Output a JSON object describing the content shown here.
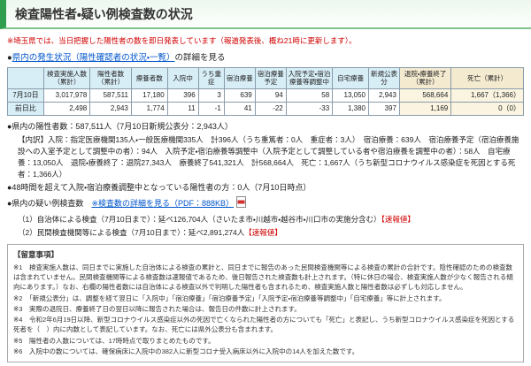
{
  "page": {
    "title": "検査陽性者・疑い例検査数の状況",
    "notice_red": "※埼玉県では、当日把握した陽性者の数を即日発表しています（報道発表後、概ね21時に更新します）。"
  },
  "status_link": {
    "prefix": "●",
    "link_text": "県内の発生状況（陽性確認者の状況・一覧）",
    "suffix": "の詳細を見る"
  },
  "table": {
    "headers": [
      "",
      "検査実施人数（累計）",
      "陽性者数（累計）",
      "療養者数",
      "入院中",
      "うち重症",
      "宿泊療養",
      "宿泊療養予定",
      "入院予定・宿泊療養等調整中",
      "自宅療養",
      "新規公表分",
      "退院・療養終了（累計）",
      "死亡（累計）"
    ],
    "rows": [
      {
        "label": "7月10日",
        "values": [
          "3,017,978",
          "587,511",
          "17,180",
          "396",
          "3",
          "639",
          "94",
          "58",
          "13,050",
          "2,943",
          "568,664",
          "1,667（1,366）"
        ]
      },
      {
        "label": "前日比",
        "values": [
          "2,498",
          "2,943",
          "1,774",
          "11",
          "-1",
          "41",
          "-22",
          "-33",
          "1,380",
          "397",
          "1,169",
          "0（0）"
        ]
      }
    ]
  },
  "summary": {
    "positives_line": "●県内の陽性者数：587,511人（7月10日新規公表分：2,943人）",
    "breakdown": "【内訳】入院：指定医療機関135人・一般医療機関335人　計396人（うち重篤者：0人　重症者：3人）　宿泊療養：639人　宿泊療養予定（宿泊療養施設への入室予定として調整中の者）：94人　入院予定・宿泊療養等調整中（入院予定として調整している者や宿泊療養を調整中の者）：58人　自宅療養：13,050人　退院・療養終了：退院27,343人　療養終了541,321人　計568,664人　死亡：1,667人（うち新型コロナウイルス感染症を死因とする死者：1,366人）",
    "over48h_line": "●48時間を超えて入院・宿泊療養調整中となっている陽性者の方：0人（7月10日時点）",
    "suspected": {
      "prefix": "●県内の疑い例検査数　",
      "link": "※検査数の詳細を見る（PDF：888KB）",
      "items": [
        {
          "text": "（1）自治体による検査（7月10日まで）：延べ126,704人（さいたま市・川越市・越谷市・川口市の実施分含む）",
          "badge": "【速報値】"
        },
        {
          "text": "（2）民間検査機関等による検査（7月10日まで）：延べ2,891,274人",
          "badge": "【速報値】"
        }
      ]
    }
  },
  "notes": {
    "title": "【留意事項】",
    "items": [
      "※1　検査実施人数は、同日までに実施した自治体による検査の累計と、同日までに報告のあった民間検査機関等による検査の累計の合計です。陰性確認のための検査数は含まれていません。民間検査機関等による検査数は速報値であるため、後日報告された検査数も計上されます。（特に休日の場合、検査実施人数が少なく報告される傾向にあります。）なお、右欄の陽性者数には自治体による検査以外で判明した陽性者も含まれるため、検査実施人数と陽性者数は必ずしも対応しません。",
      "※2　「新規公表分」は、調整を経て翌日に「入院中」「宿泊療養」「宿泊療養予定」「入院予定・宿泊療養等調整中」「自宅療養」等に計上されます。",
      "※3　実際の退院日、療養終了日の翌日以降に報告された場合は、報告日の件数に計上されます。",
      "※4　令和2年6月19日以降、新型コロナウイルス感染症以外の死因で亡くなられた陽性者の方についても「死亡」と表記し、うち新型コロナウイルス感染症を死因とする死者を（　）内に内数として表記しています。なお、死亡には県外公表分も含まれます。",
      "※5　陽性者の人数については、17時時点で取りまとめたものです。",
      "※6　入院中の数については、確保病床に入院中の382人に新型コロナ受入病床以外に入院中の14人を加えた数です。"
    ]
  }
}
